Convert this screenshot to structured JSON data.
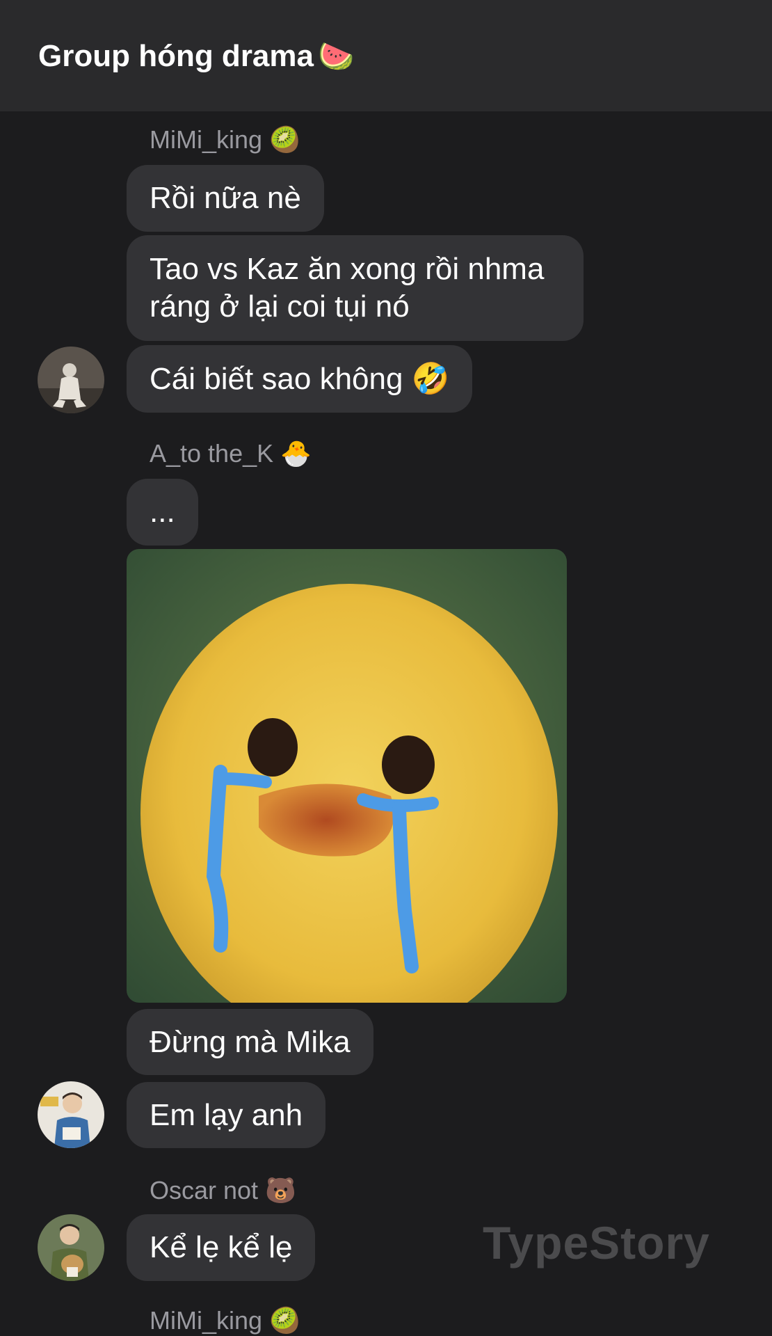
{
  "header": {
    "title": "Group hóng drama",
    "title_emoji": "🍉"
  },
  "messages": {
    "sender1": {
      "name": "MiMi_king",
      "emoji": "🥝"
    },
    "m1": "Rồi nữa nè",
    "m2": "Tao vs Kaz ăn xong rồi nhma ráng ở lại coi tụi nó",
    "m3": "Cái biết sao không 🤣",
    "sender2": {
      "name": "A_to the_K",
      "emoji": "🐣"
    },
    "m4": "...",
    "m5": "Đừng mà Mika",
    "m6": "Em lạy anh",
    "sender3": {
      "name": "Oscar not",
      "emoji": "🐻"
    },
    "m7": "Kể lẹ kể lẹ",
    "sender4": {
      "name": "MiMi_king",
      "emoji": "🥝"
    }
  },
  "watermark": "TypeStory",
  "icons": {
    "photo": "crying-duck-image",
    "avatar1": "user-avatar",
    "avatar2": "user-avatar",
    "avatar3": "user-avatar"
  },
  "colors": {
    "background": "#1c1c1e",
    "header": "#2a2a2c",
    "bubble": "#333336",
    "sender_text": "#9a9aa0"
  }
}
